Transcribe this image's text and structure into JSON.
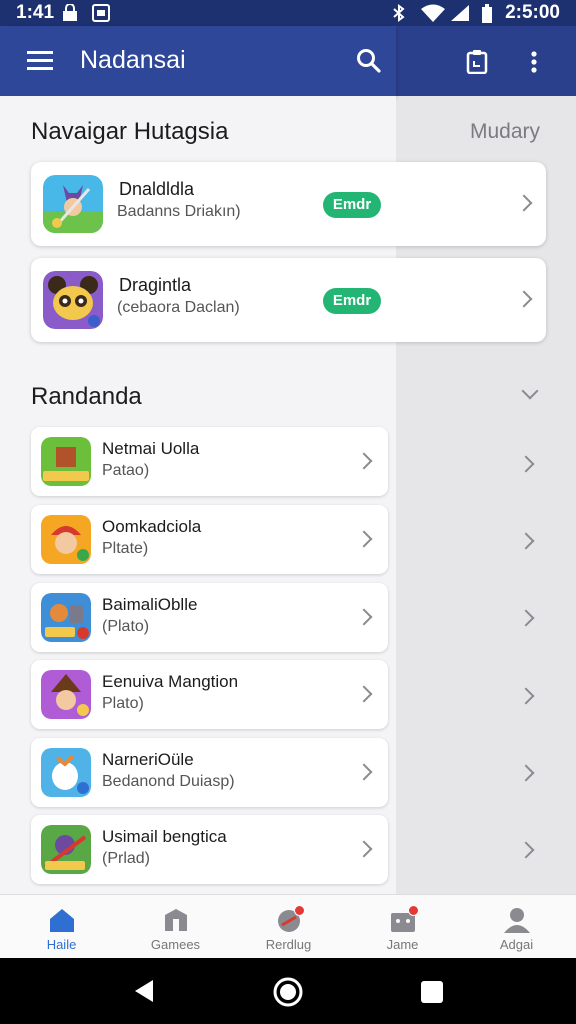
{
  "status_bar": {
    "time_left": "1:41",
    "time_right": "2:5:00"
  },
  "drawer": {
    "title": "Nadansai",
    "featured_section": {
      "title": "Navaigar Hutagsia",
      "items": [
        {
          "name": "Dnaldldla",
          "subtitle": "Badanns Driakın)",
          "pill": "Emdr",
          "icon": "game-icon-warrior"
        },
        {
          "name": "Dragintla",
          "subtitle": "(cebaora Daclan)",
          "pill": "Emdr",
          "icon": "game-icon-bear"
        }
      ]
    },
    "list_section": {
      "title": "Randanda",
      "items": [
        {
          "name": "Netmai Uolla",
          "subtitle": "Patao)",
          "icon": "game-icon-farm"
        },
        {
          "name": "Oomkadciola",
          "subtitle": "Pltate)",
          "icon": "game-icon-hero"
        },
        {
          "name": "BaimaliOblle",
          "subtitle": "(Plato)",
          "icon": "game-icon-robot"
        },
        {
          "name": "Eenuiva Mangtion",
          "subtitle": "Plato)",
          "icon": "game-icon-witch"
        },
        {
          "name": "NarneriOüle",
          "subtitle": "Bedanond Duiasp)",
          "icon": "game-icon-bird"
        },
        {
          "name": "Usimail bengtica",
          "subtitle": "(Prlad)",
          "icon": "game-icon-knight"
        }
      ]
    }
  },
  "background_page": {
    "header_label": "Mudary"
  },
  "bottom_nav": {
    "items": [
      {
        "label": "Haile",
        "icon": "home-icon",
        "active": true
      },
      {
        "label": "Gamees",
        "icon": "games-icon",
        "active": false
      },
      {
        "label": "Rerdlug",
        "icon": "record-icon",
        "active": false
      },
      {
        "label": "Jame",
        "icon": "store-icon",
        "active": false
      },
      {
        "label": "Adgai",
        "icon": "profile-icon",
        "active": false
      }
    ]
  },
  "colors": {
    "appbar": "#2f4799",
    "accent": "#2f6fd1",
    "pill": "#22b573",
    "badge": "#e53935"
  }
}
